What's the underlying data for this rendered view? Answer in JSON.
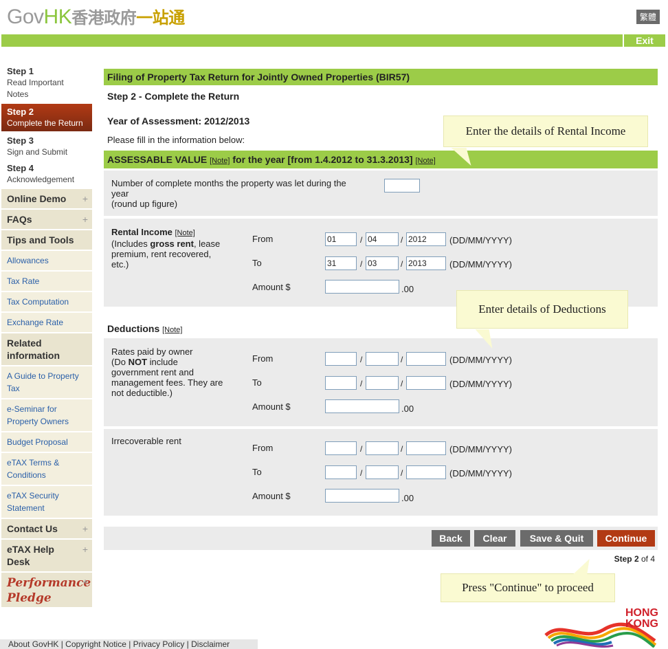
{
  "header": {
    "logo_gov": "Gov",
    "logo_hk": "HK",
    "logo_cn1": "香港政府",
    "logo_cn2": "一站通",
    "lang_button": "繁體",
    "exit": "Exit"
  },
  "sidebar": {
    "steps": [
      {
        "num": "Step 1",
        "label": "Read Important Notes"
      },
      {
        "num": "Step 2",
        "label": "Complete the Return"
      },
      {
        "num": "Step 3",
        "label": "Sign and Submit"
      },
      {
        "num": "Step 4",
        "label": "Acknowledgement"
      }
    ],
    "online_demo": "Online Demo",
    "faqs": "FAQs",
    "tips_tools": "Tips and Tools",
    "tips_links": [
      "Allowances",
      "Tax Rate",
      "Tax Computation",
      "Exchange Rate"
    ],
    "related_info": "Related information",
    "related_links": [
      "A Guide to Property Tax",
      "e-Seminar for Property Owners",
      "Budget Proposal",
      "eTAX Terms & Conditions",
      "eTAX Security Statement"
    ],
    "contact_us": "Contact Us",
    "etax_help": "eTAX Help Desk",
    "perf_pledge_1": "Performance",
    "perf_pledge_2": "Pledge",
    "plus_sign": "+"
  },
  "main": {
    "title": "Filing of Property Tax Return for Jointly Owned Properties (BIR57)",
    "step_heading": "Step 2 - Complete the Return",
    "year_label": "Year of Assessment:",
    "year_value": "2012/2013",
    "fill_info": "Please fill in the information below:",
    "av_label": "ASSESSABLE VALUE",
    "av_mid": "for the year",
    "av_period": "[from 1.4.2012 to 31.3.2013]",
    "note": "[Note]",
    "months_label_1": "Number of complete months the property was let during the",
    "months_label_2": "year",
    "months_label_3": "(round up figure)",
    "months_value": "",
    "rental_label": "Rental Income",
    "rental_desc_1": "(Includes",
    "rental_desc_bold": "gross rent",
    "rental_desc_2": ", lease",
    "rental_desc_3": "premium, rent recovered,",
    "rental_desc_4": "etc.)",
    "from": "From",
    "to": "To",
    "amount": "Amount $",
    "cents": ".00",
    "date_fmt": "(DD/MM/YYYY)",
    "slash": "/",
    "rental_from": {
      "dd": "01",
      "mm": "04",
      "yyyy": "2012"
    },
    "rental_to": {
      "dd": "31",
      "mm": "03",
      "yyyy": "2013"
    },
    "rental_amount": "",
    "deductions_label": "Deductions",
    "rates_label_1": "Rates paid by owner",
    "rates_label_2": "(Do",
    "rates_label_not": "NOT",
    "rates_label_3": "include",
    "rates_label_4": "government rent and",
    "rates_label_5": "management fees. They are",
    "rates_label_6": "not deductible.)",
    "irrecoverable_label": "Irrecoverable rent",
    "buttons": {
      "back": "Back",
      "clear": "Clear",
      "save_quit": "Save & Quit",
      "continue": "Continue"
    },
    "step_of_bold": "Step 2",
    "step_of_rest": "of 4"
  },
  "callouts": {
    "rental": "Enter the details of Rental Income",
    "deductions": "Enter details of Deductions",
    "continue": "Press \"Continue\" to proceed"
  },
  "footer": {
    "links": "About GovHK | Copyright Notice | Privacy Policy | Disclaimer"
  },
  "hk_logo": {
    "line1": "HONG",
    "line2": "KONG"
  },
  "colors": {
    "accent_green": "#9ccc48",
    "accent_red": "#b23a14",
    "panel_grey": "#ebebeb",
    "sidebar_beige": "#e9e4cf"
  }
}
